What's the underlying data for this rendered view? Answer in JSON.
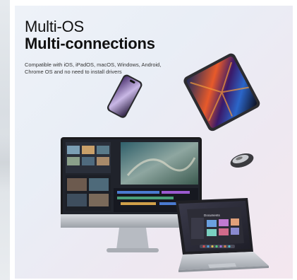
{
  "banner": {
    "title_line1": "Multi-OS",
    "title_line2": "Multi-connections",
    "subtitle": "Compatible with iOS, iPadOS, macOS, Windows, Android, Chrome OS and no need to install drivers"
  },
  "laptop_screen": {
    "window_title": "Documents"
  },
  "colors": {
    "panel_bg_start": "#eef2f8",
    "panel_bg_end": "#f4e7ef",
    "text": "#111111"
  }
}
